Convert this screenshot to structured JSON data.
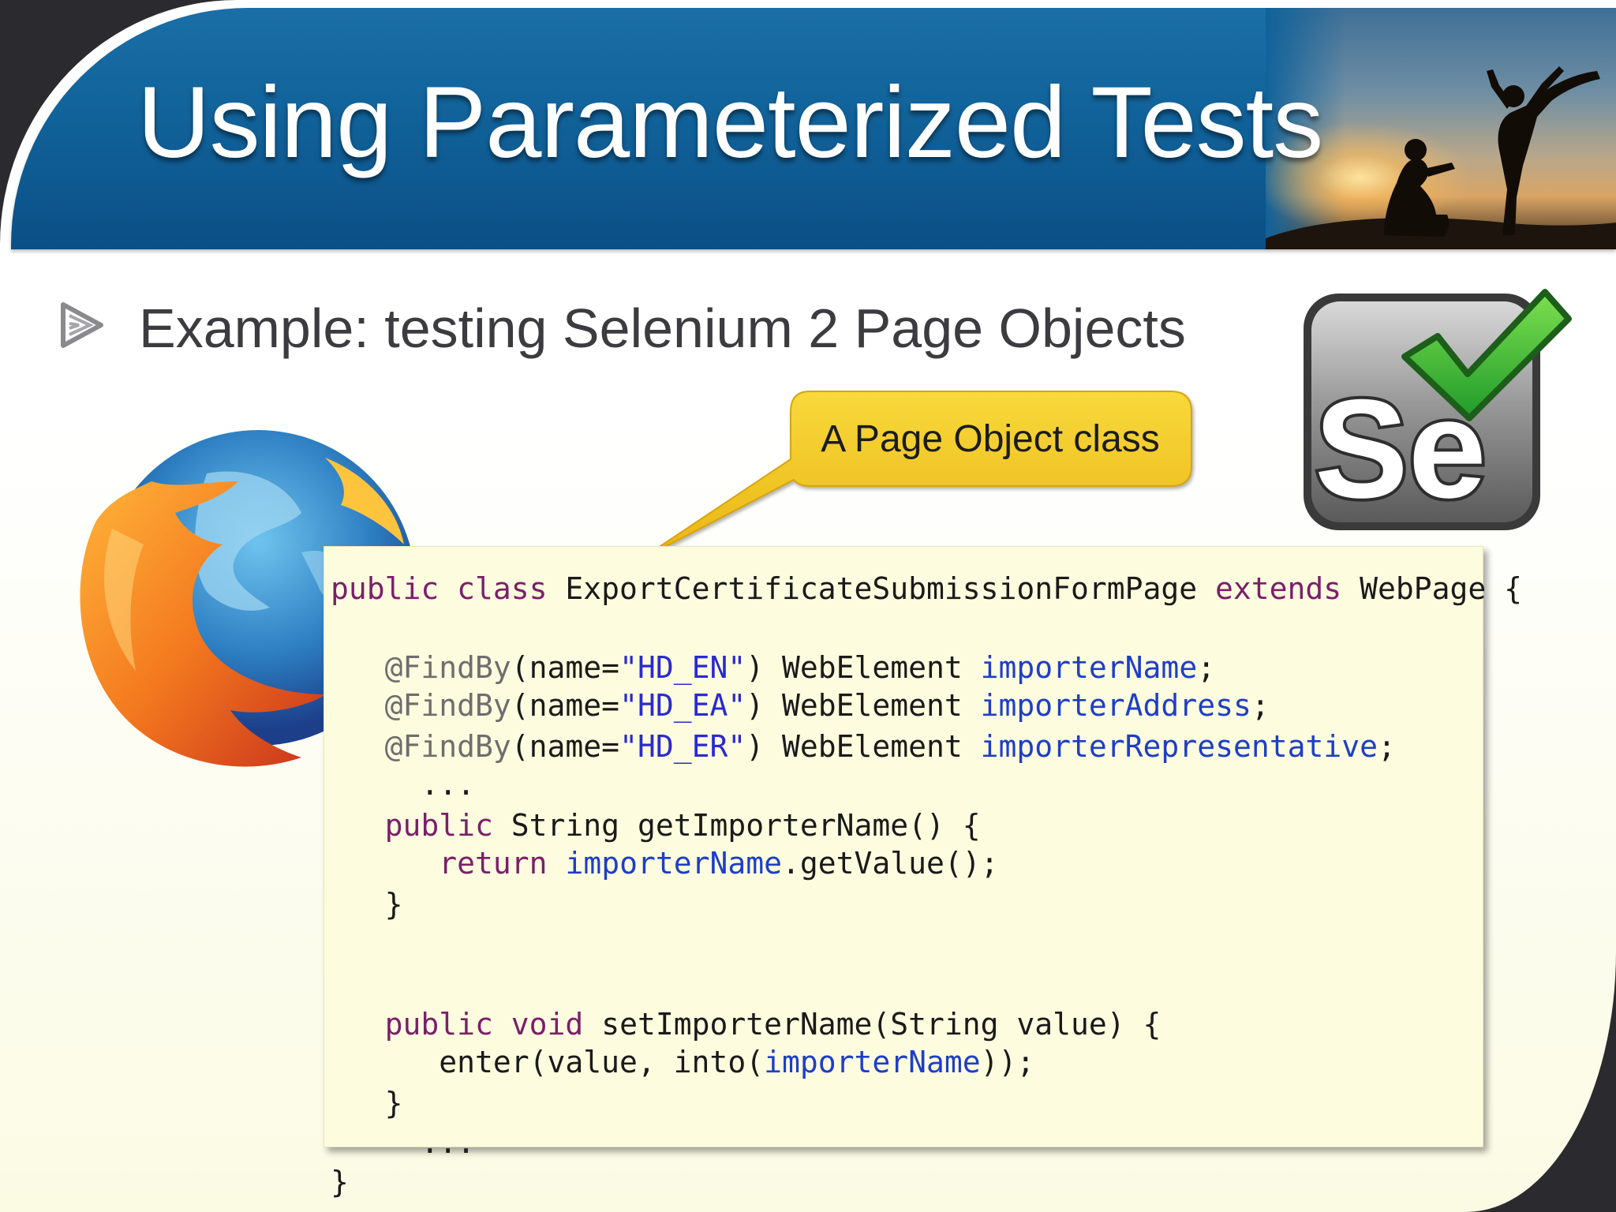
{
  "slide": {
    "title": "Using Parameterized Tests",
    "bullet": "Example: testing Selenium 2 Page Objects",
    "callout": "A Page Object class"
  },
  "logos": {
    "selenium_text": "Se"
  },
  "code": {
    "lines": [
      [
        [
          "kw",
          "public class "
        ],
        [
          "",
          "ExportCertificateSubmissionFormPage "
        ],
        [
          "kw",
          "extends "
        ],
        [
          "",
          "WebPage {"
        ]
      ],
      [],
      [
        [
          "",
          "   "
        ],
        [
          "ann",
          "@FindBy"
        ],
        [
          "",
          "(name="
        ],
        [
          "str",
          "\"HD_EN\""
        ],
        [
          "",
          ") WebElement "
        ],
        [
          "fld",
          "importerName"
        ],
        [
          "",
          ";"
        ]
      ],
      [
        [
          "",
          "   "
        ],
        [
          "ann",
          "@FindBy"
        ],
        [
          "",
          "(name="
        ],
        [
          "str",
          "\"HD_EA\""
        ],
        [
          "",
          ") WebElement "
        ],
        [
          "fld",
          "importerAddress"
        ],
        [
          "",
          ";"
        ]
      ],
      [
        [
          "",
          "   "
        ],
        [
          "ann",
          "@FindBy"
        ],
        [
          "",
          "(name="
        ],
        [
          "str",
          "\"HD_ER\""
        ],
        [
          "",
          ") WebElement "
        ],
        [
          "fld",
          "importerRepresentative"
        ],
        [
          "",
          ";"
        ]
      ],
      [
        [
          "",
          "     ..."
        ]
      ],
      [
        [
          "",
          "   "
        ],
        [
          "kw",
          "public "
        ],
        [
          "",
          "String getImporterName() {"
        ]
      ],
      [
        [
          "",
          "      "
        ],
        [
          "kw",
          "return "
        ],
        [
          "fld",
          "importerName"
        ],
        [
          "",
          ".getValue();"
        ]
      ],
      [
        [
          "",
          "   }"
        ]
      ],
      [],
      [
        [
          "",
          "   "
        ],
        [
          "kw",
          "public void "
        ],
        [
          "",
          "setImporterName(String value) {"
        ]
      ],
      [
        [
          "",
          "      enter(value, into("
        ],
        [
          "fld",
          "importerName"
        ],
        [
          "",
          "));"
        ]
      ],
      [
        [
          "",
          "   }"
        ]
      ],
      [
        [
          "",
          "     ..."
        ]
      ],
      [
        [
          "",
          "}"
        ]
      ]
    ]
  },
  "colors": {
    "banner": "#11629a",
    "code_background": "#fdfcdf",
    "keyword": "#7b1f6a",
    "string": "#2a2ad0",
    "field": "#1e3ec8",
    "callout": "#f2c21a"
  },
  "icons": [
    "bullet-arrow-icon",
    "firefox-logo-icon",
    "selenium-logo-icon"
  ]
}
